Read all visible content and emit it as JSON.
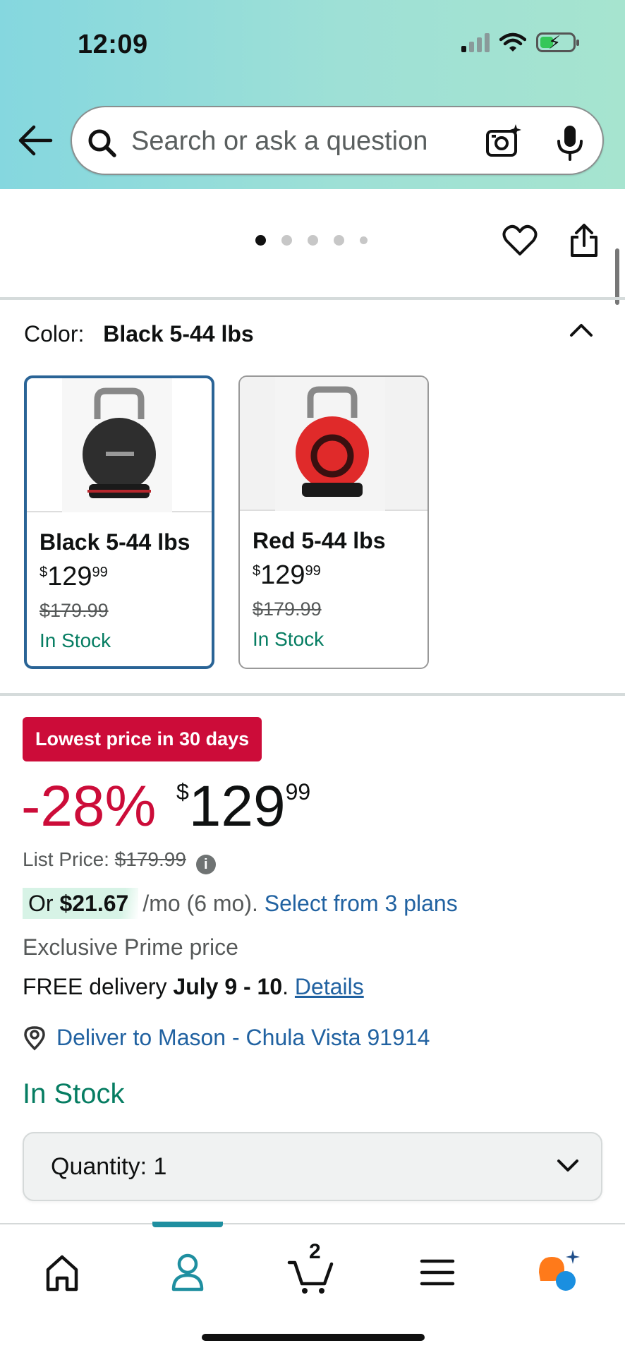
{
  "status_bar": {
    "time": "12:09"
  },
  "search": {
    "placeholder": "Search or ask a question"
  },
  "gallery": {
    "dot_count": 5,
    "active_index": 0
  },
  "color_selector": {
    "label": "Color:",
    "selected_value": "Black 5-44 lbs",
    "options": [
      {
        "name": "Black 5-44 lbs",
        "price_symbol": "$",
        "price_whole": "129",
        "price_fraction": "99",
        "list_price": "$179.99",
        "availability": "In Stock",
        "selected": true
      },
      {
        "name": "Red 5-44 lbs",
        "price_symbol": "$",
        "price_whole": "129",
        "price_fraction": "99",
        "list_price": "$179.99",
        "availability": "In Stock",
        "selected": false
      }
    ]
  },
  "pricing": {
    "badge": "Lowest price in 30 days",
    "discount": "-28%",
    "price_symbol": "$",
    "price_whole": "129",
    "price_fraction": "99",
    "list_price_label": "List Price:",
    "list_price": "$179.99",
    "monthly_prefix": "Or",
    "monthly_amount": "$21.67",
    "monthly_suffix": "/mo (6 mo).",
    "plans_link": "Select from 3 plans",
    "exclusive": "Exclusive Prime price"
  },
  "delivery": {
    "prefix": "FREE delivery",
    "dates": "July 9 - 10",
    "period": ".",
    "details_link": "Details",
    "deliver_to": "Deliver to Mason - Chula Vista 91914"
  },
  "availability": "In Stock",
  "quantity": {
    "label": "Quantity:",
    "value": "1"
  },
  "bottom_nav": {
    "cart_count": "2",
    "items": [
      "home-icon",
      "account-icon",
      "cart-icon",
      "menu-icon",
      "rufus-icon"
    ],
    "active": "account-icon"
  },
  "colors": {
    "link": "#2162a1",
    "deal_red": "#cc0c39",
    "stock_green": "#067d62",
    "selected_border": "#2a6496"
  }
}
